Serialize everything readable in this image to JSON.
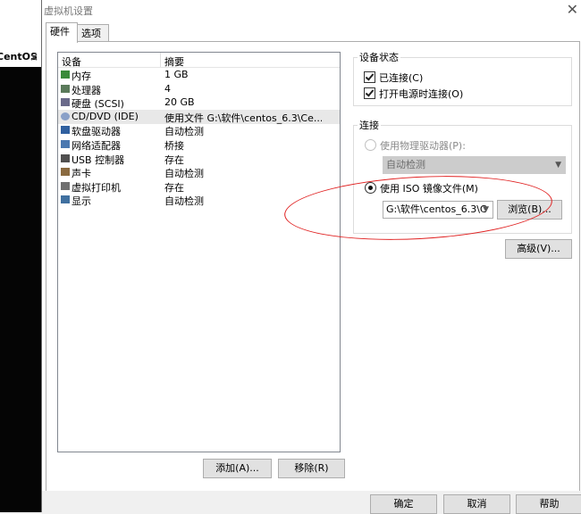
{
  "background_app": {
    "tab_title": "CentOS",
    "tab_close": "×"
  },
  "dialog": {
    "title": "虚拟机设置",
    "close": "✕"
  },
  "tabs": [
    {
      "label": "硬件"
    },
    {
      "label": "选项"
    }
  ],
  "device_list": {
    "headers": {
      "device": "设备",
      "summary": "摘要"
    },
    "rows": [
      {
        "device": "内存",
        "summary": "1 GB",
        "icon": "memory-icon"
      },
      {
        "device": "处理器",
        "summary": "4",
        "icon": "processor-icon"
      },
      {
        "device": "硬盘 (SCSI)",
        "summary": "20 GB",
        "icon": "hard-disk-icon"
      },
      {
        "device": "CD/DVD (IDE)",
        "summary": "使用文件 G:\\软件\\centos_6.3\\Ce...",
        "icon": "cd-dvd-icon",
        "selected": true
      },
      {
        "device": "软盘驱动器",
        "summary": "自动检测",
        "icon": "floppy-icon"
      },
      {
        "device": "网络适配器",
        "summary": "桥接",
        "icon": "network-adapter-icon"
      },
      {
        "device": "USB 控制器",
        "summary": "存在",
        "icon": "usb-icon"
      },
      {
        "device": "声卡",
        "summary": "自动检测",
        "icon": "sound-card-icon"
      },
      {
        "device": "虚拟打印机",
        "summary": "存在",
        "icon": "printer-icon"
      },
      {
        "device": "显示",
        "summary": "自动检测",
        "icon": "display-icon"
      }
    ]
  },
  "buttons": {
    "add": "添加(A)...",
    "remove": "移除(R)",
    "browse": "浏览(B)...",
    "advanced": "高级(V)...",
    "ok": "确定",
    "cancel": "取消",
    "help": "帮助"
  },
  "device_status": {
    "title": "设备状态",
    "connected": "已连接(C)",
    "connect_on_power": "打开电源时连接(O)"
  },
  "connection": {
    "title": "连接",
    "physical_drive_label": "使用物理驱动器(P):",
    "physical_drive_value": "自动检测",
    "iso_label": "使用 ISO 镜像文件(M)",
    "iso_path": "G:\\软件\\centos_6.3\\C"
  },
  "colors": {
    "annotation": "#e02020",
    "selected_row": "#e8e8e8"
  }
}
